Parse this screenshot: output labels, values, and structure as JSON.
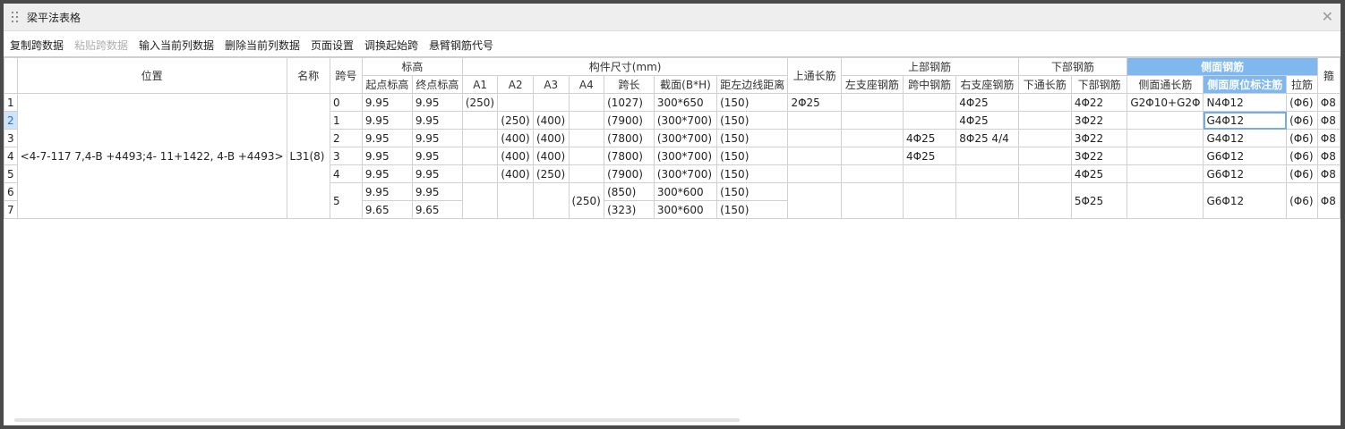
{
  "window": {
    "title": "梁平法表格"
  },
  "toolbar": [
    {
      "label": "复制跨数据",
      "enabled": true
    },
    {
      "label": "粘贴跨数据",
      "enabled": false
    },
    {
      "label": "输入当前列数据",
      "enabled": true
    },
    {
      "label": "删除当前列数据",
      "enabled": true
    },
    {
      "label": "页面设置",
      "enabled": true
    },
    {
      "label": "调换起始跨",
      "enabled": true
    },
    {
      "label": "悬臂钢筋代号",
      "enabled": true
    }
  ],
  "headers": {
    "position": "位置",
    "name": "名称",
    "span": "跨号",
    "elevation": "标高",
    "start_elev": "起点标高",
    "end_elev": "终点标高",
    "dims": "构件尺寸(mm)",
    "a1": "A1",
    "a2": "A2",
    "a3": "A3",
    "a4": "A4",
    "span_len": "跨长",
    "section": "截面(B*H)",
    "left_dist": "距左边线距离",
    "top_through": "上通长筋",
    "top_rebar": "上部钢筋",
    "left_support": "左支座钢筋",
    "mid_span": "跨中钢筋",
    "right_support": "右支座钢筋",
    "bottom_rebar": "下部钢筋",
    "bottom_through": "下通长筋",
    "bottom_bars": "下部钢筋",
    "side_rebar": "侧面钢筋",
    "side_through": "侧面通长筋",
    "side_mark": "侧面原位标注筋",
    "tie": "拉筋",
    "cut_top": "箍",
    "cut_cell": "Φ8"
  },
  "beam": {
    "position": "<4-7-117 7,4-B +4493;4- 11+1422, 4-B +4493>",
    "name": "L31(8)"
  },
  "row_numbers": [
    "1",
    "2",
    "3",
    "4",
    "5",
    "6",
    "7"
  ],
  "rows": [
    {
      "span": "0",
      "start_elev": "9.95",
      "end_elev": "9.95",
      "a1": "(250)",
      "a2": "",
      "a3": "",
      "a4": "",
      "span_len": "(1027)",
      "section": "300*650",
      "left_dist": "(150)",
      "top_through": "2Φ25",
      "left_support": "",
      "mid_span": "",
      "right_support": "4Φ25",
      "bottom_through": "",
      "bottom_bars": "4Φ22",
      "side_through": "G2Φ10+G2Φ",
      "side_mark": "N4Φ12",
      "tie": "(Φ6)"
    },
    {
      "span": "1",
      "start_elev": "9.95",
      "end_elev": "9.95",
      "a1": "",
      "a2": "(250)",
      "a3": "(400)",
      "a4": "",
      "span_len": "(7900)",
      "section": "(300*700)",
      "left_dist": "(150)",
      "top_through": "",
      "left_support": "",
      "mid_span": "",
      "right_support": "4Φ25",
      "bottom_through": "",
      "bottom_bars": "3Φ22",
      "side_through": "",
      "side_mark": "G4Φ12",
      "tie": "(Φ6)"
    },
    {
      "span": "2",
      "start_elev": "9.95",
      "end_elev": "9.95",
      "a1": "",
      "a2": "(400)",
      "a3": "(400)",
      "a4": "",
      "span_len": "(7800)",
      "section": "(300*700)",
      "left_dist": "(150)",
      "top_through": "",
      "left_support": "",
      "mid_span": "4Φ25",
      "right_support": "8Φ25 4/4",
      "bottom_through": "",
      "bottom_bars": "3Φ22",
      "side_through": "",
      "side_mark": "G4Φ12",
      "tie": "(Φ6)"
    },
    {
      "span": "3",
      "start_elev": "9.95",
      "end_elev": "9.95",
      "a1": "",
      "a2": "(400)",
      "a3": "(400)",
      "a4": "",
      "span_len": "(7800)",
      "section": "(300*700)",
      "left_dist": "(150)",
      "top_through": "",
      "left_support": "",
      "mid_span": "4Φ25",
      "right_support": "",
      "bottom_through": "",
      "bottom_bars": "3Φ22",
      "side_through": "",
      "side_mark": "G6Φ12",
      "tie": "(Φ6)"
    },
    {
      "span": "4",
      "start_elev": "9.95",
      "end_elev": "9.95",
      "a1": "",
      "a2": "(400)",
      "a3": "(250)",
      "a4": "",
      "span_len": "(7900)",
      "section": "(300*700)",
      "left_dist": "(150)",
      "top_through": "",
      "left_support": "",
      "mid_span": "",
      "right_support": "",
      "bottom_through": "",
      "bottom_bars": "4Φ25",
      "side_through": "",
      "side_mark": "G6Φ12",
      "tie": "(Φ6)"
    }
  ],
  "span5": {
    "span": "5",
    "start_elev": [
      "9.95",
      "9.65"
    ],
    "end_elev": [
      "9.95",
      "9.65"
    ],
    "a4": "(250)",
    "span_len": [
      "(850)",
      "(323)"
    ],
    "section": [
      "300*600",
      "300*600"
    ],
    "left_dist": [
      "(150)",
      "(150)"
    ],
    "bottom_bars": "5Φ25",
    "side_mark": "G6Φ12",
    "tie": "(Φ6)"
  },
  "colors": {
    "selected_header_bg": "#7fb8ee",
    "current_cell_border": "#74ace8",
    "grid_line": "#d0d0d0"
  }
}
